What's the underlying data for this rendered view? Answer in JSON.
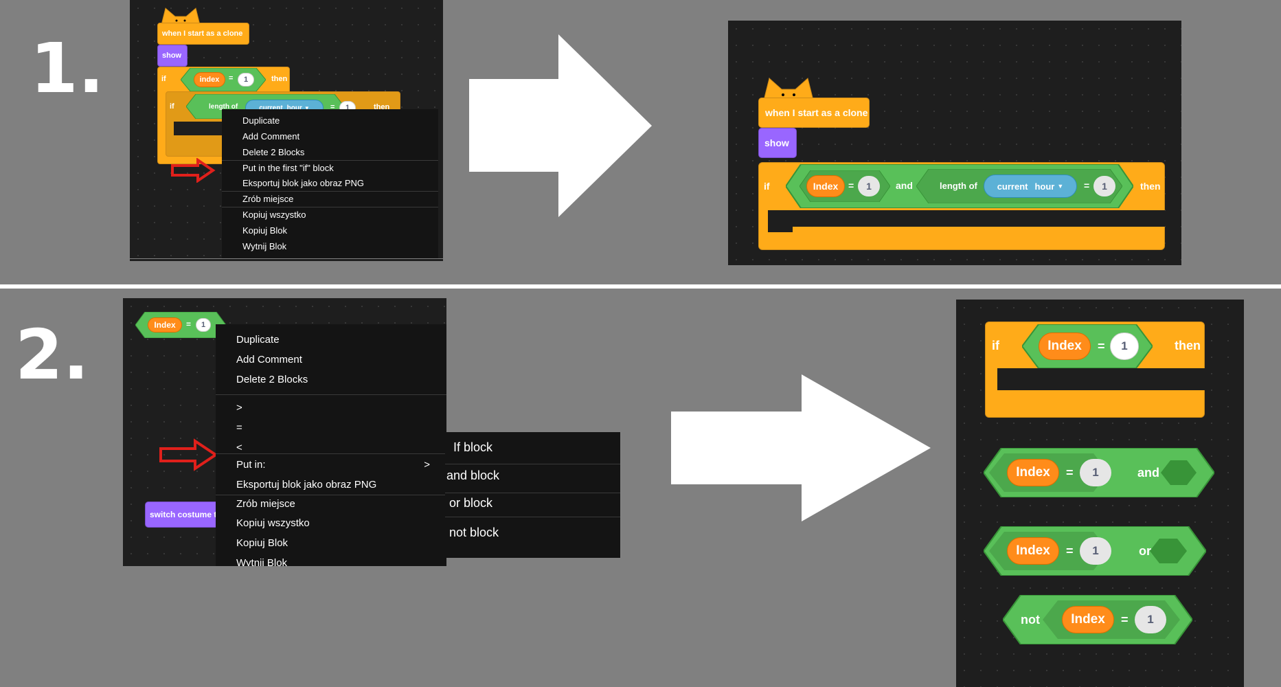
{
  "steps": {
    "one": "1.",
    "two": "2."
  },
  "blocks": {
    "hat": "when I start as a clone",
    "show": "show",
    "if": "if",
    "then": "then",
    "and": "and",
    "or": "or",
    "not": "not",
    "index": "Index",
    "index_lower": "index",
    "eq": "=",
    "one": "1",
    "length_of": "length of",
    "current": "current",
    "hour": "hour",
    "switch_costume": "switch costume t"
  },
  "menu1": {
    "items": [
      "Duplicate",
      "Add Comment",
      "Delete 2 Blocks",
      "Put in the first \"if\" block",
      "Eksportuj blok jako obraz PNG",
      "Zrób miejsce",
      "Kopiuj wszystko",
      "Kopiuj Blok",
      "Wytnij Blok"
    ]
  },
  "menu2": {
    "items": [
      "Duplicate",
      "Add Comment",
      "Delete 2 Blocks",
      ">",
      "=",
      "<",
      "Put in:",
      "Eksportuj blok jako obraz PNG",
      "Zrób miejsce",
      "Kopiuj wszystko",
      "Kopiuj Blok",
      "Wytnij Blok"
    ],
    "submenu_indicator": ">"
  },
  "submenu": {
    "items": [
      "If block",
      "and block",
      "or block",
      "not block"
    ]
  },
  "colors": {
    "background": "#808080",
    "panel": "#1e1e1e",
    "control": "#ffab19",
    "looks": "#9966ff",
    "operator": "#59c059",
    "variable": "#ff8c1a",
    "sensing": "#5cb1d6",
    "pointer_arrow": "#e0201b"
  }
}
